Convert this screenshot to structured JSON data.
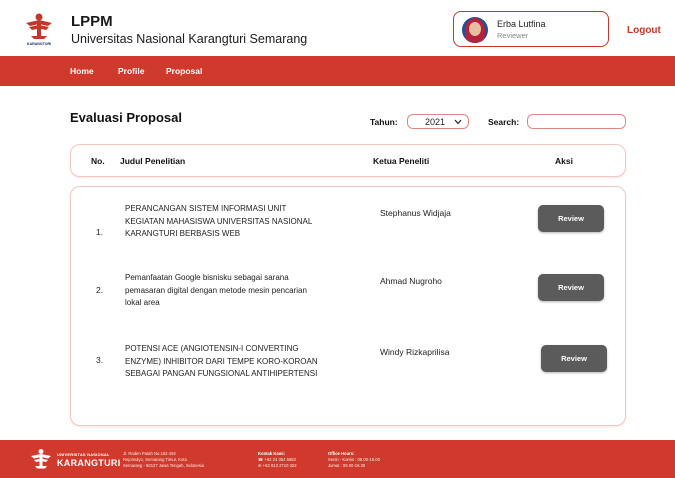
{
  "header": {
    "org_title": "LPPM",
    "org_subtitle": "Universitas Nasional Karangturi Semarang",
    "user_name": "Erba Lutfina",
    "user_role": "Reviewer",
    "logout_label": "Logout",
    "logo_text": "KARANGTURI"
  },
  "nav": {
    "items": [
      {
        "label": "Home"
      },
      {
        "label": "Profile"
      },
      {
        "label": "Proposal"
      }
    ]
  },
  "main": {
    "title": "Evaluasi Proposal",
    "year_label": "Tahun:",
    "year_value": "2021",
    "search_label": "Search:",
    "search_value": ""
  },
  "table": {
    "columns": [
      "No.",
      "Judul Penelitian",
      "Ketua Peneliti",
      "Aksi"
    ],
    "rows": [
      {
        "no": "1.",
        "judul": "PERANCANGAN SISTEM INFORMASI UNIT KEGIATAN MAHASISWA UNIVERSITAS NASIONAL KARANGTURI BERBASIS WEB",
        "ketua": "Stephanus Widjaja",
        "aksi": "Review"
      },
      {
        "no": "2.",
        "judul": "Pemanfaatan Google bisnisku sebagai sarana pemasaran digital dengan metode mesin pencarian lokal area",
        "ketua": "Ahmad Nugroho",
        "aksi": "Review"
      },
      {
        "no": "3.",
        "judul": "POTENSI ACE (ANGIOTENSIN-I CONVERTING ENZYME) INHIBITOR DARI TEMPE KORO-KOROAN SEBAGAI PANGAN FUNGSIONAL ANTIHIPERTENSI",
        "ketua": "Windy Rizkaprilisa",
        "aksi": "Review"
      }
    ]
  },
  "footer": {
    "uni_line1": "UNIVERSITAS NASIONAL",
    "uni_line2": "KARANGTURI",
    "address": [
      "Jl. Raden Patah No.182-192",
      "Rejomulyo, Semarang Timur, Kota",
      "Semarang - 50127 Jawa Tengah, Indonesia"
    ],
    "contact_heading": "Kontak Kami:",
    "contact": [
      "☎ +62 24 354 5682",
      "✉ +62 813 2710 322"
    ],
    "hours_heading": "Office Hours:",
    "hours": [
      "Senin - Kamis : 08.00-16.00",
      "Jumat : 08.00-16.30"
    ]
  },
  "colors": {
    "brand_red": "#cf3a2d",
    "button_gray": "#5b5b5b",
    "border_pink": "#f0c8c2"
  },
  "icons": [
    "university-logo",
    "avatar",
    "chevron-down-icon"
  ]
}
